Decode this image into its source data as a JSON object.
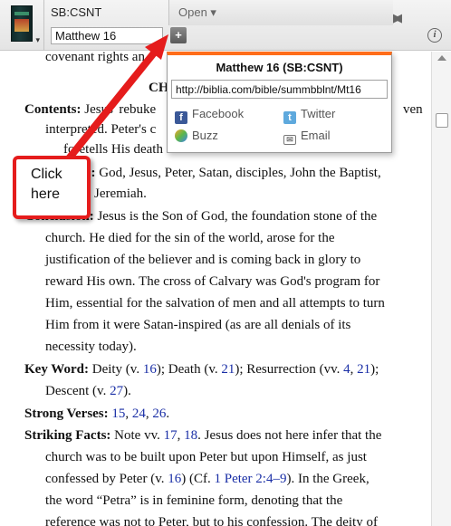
{
  "toolbar": {
    "resource_name": "SB:CSNT",
    "open_label": "Open ▾",
    "reference_value": "Matthew 16",
    "nav_back": "◀",
    "nav_forward": "▶",
    "share_glyph": "+",
    "info_glyph": "i"
  },
  "content": {
    "line_top": "covenant rights an",
    "chapter_heading_partial": "CH",
    "contents_label": "Contents:",
    "contents_l1": "Jesus' rebuke",
    "contents_l1_end": "ven",
    "contents_l2": "interpreted. Peter's c",
    "contents_l3": "foretells His death and resurrection.",
    "characters_label_partial": "rs:",
    "characters_l1": "God, Jesus, Peter, Satan, disciples, John the Baptist,",
    "characters_l2": "Jeremiah.",
    "conclusion_label": "Conclusion:",
    "conclusion_l1": "Jesus is the Son of God, the foundation stone of the",
    "conclusion_l2": "church. He died for the sin of the world, arose for the",
    "conclusion_l3": "justification of the believer and is coming back in glory to",
    "conclusion_l4": "reward His own. The cross of Calvary was God's program for",
    "conclusion_l5": "Him, essential for the salvation of men and all attempts to turn",
    "conclusion_l6": "Him from it were Satan-inspired (as are all denials of its",
    "conclusion_l7": "necessity today).",
    "keyword_label": "Key Word:",
    "keyword_l1a": "Deity (v. ",
    "keyword_ref1": "16",
    "keyword_l1b": "); Death (v. ",
    "keyword_ref2": "21",
    "keyword_l1c": "); Resurrection (vv. ",
    "keyword_ref3": "4",
    "keyword_l1d": ", ",
    "keyword_ref4": "21",
    "keyword_l1e": ");",
    "keyword_l2a": "Descent (v. ",
    "keyword_ref5": "27",
    "keyword_l2b": ").",
    "strong_label": "Strong Verses:",
    "strong_ref1": "15",
    "strong_ref2": "24",
    "strong_ref3": "26",
    "strong_sep1": ", ",
    "strong_sep2": ", ",
    "strong_end": ".",
    "striking_label": "Striking Facts:",
    "striking_l1a": "Note vv. ",
    "striking_ref1": "17",
    "striking_sep": ", ",
    "striking_ref2": "18",
    "striking_l1b": ". Jesus does not here infer that the",
    "striking_l2": "church was to be built upon Peter but upon Himself, as just",
    "striking_l3a": "confessed by Peter (v. ",
    "striking_ref3": "16",
    "striking_l3b": ") (Cf. ",
    "striking_ref4": "1 Peter 2:4–9",
    "striking_l3c": "). In the Greek,",
    "striking_l4": "the word “Petra” is in feminine form, denoting that the",
    "striking_l5": "reference was not to Peter, but to his confession. The deity of"
  },
  "share_popup": {
    "title": "Matthew 16 (SB:CSNT)",
    "url": "http://biblia.com/bible/summbblnt/Mt16",
    "facebook": "Facebook",
    "twitter": "Twitter",
    "buzz": "Buzz",
    "email": "Email"
  },
  "callout": {
    "text_line1": "Click",
    "text_line2": "here",
    "color": "#e51c1c"
  },
  "colors": {
    "accent_orange": "#ff6d1a",
    "link_blue": "#1a2fa6"
  }
}
